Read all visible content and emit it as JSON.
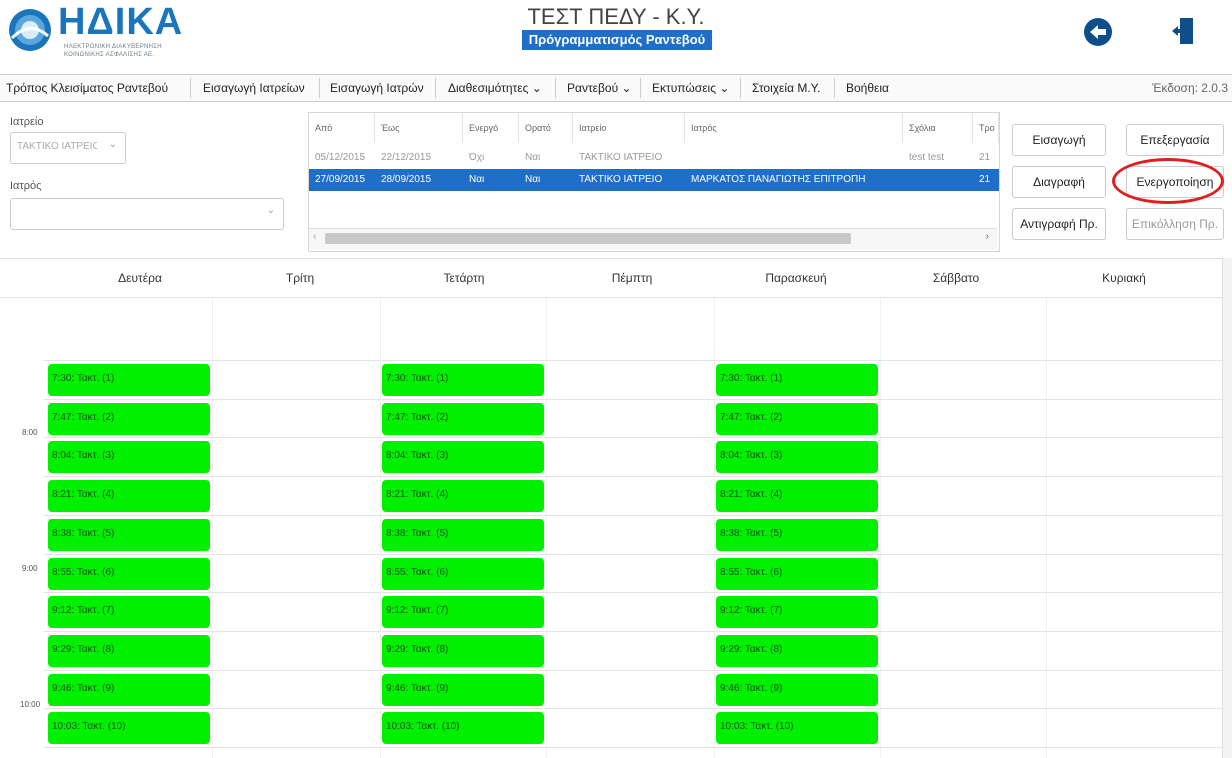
{
  "header": {
    "logo_text": "ΗΔΙΚΑ",
    "logo_sub_line1": "ΗΛΕΚΤΡΟΝΙΚΗ ΔΙΑΚΥΒΕΡΝΗΣΗ",
    "logo_sub_line2": "ΚΟΙΝΩΝΙΚΗΣ ΑΣΦΑΛΙΣΗΣ ΑΕ.",
    "title": "ΤΕΣΤ ΠΕΔΥ - Κ.Υ.",
    "subtitle": "Πρόγραμματισμός Ραντεβού"
  },
  "menu": {
    "items": [
      {
        "label": "Τρόπος Κλεισίματος Ραντεβού"
      },
      {
        "label": "Εισαγωγή Ιατρείων"
      },
      {
        "label": "Εισαγωγή Ιατρών"
      },
      {
        "label": "Διαθεσιμότητες ⌄"
      },
      {
        "label": "Ραντεβού ⌄"
      },
      {
        "label": "Εκτυπώσεις ⌄"
      },
      {
        "label": "Στοιχεία Μ.Υ."
      },
      {
        "label": "Βοήθεια"
      }
    ],
    "version": "Έκδοση: 2.0.3"
  },
  "filters": {
    "office_label": "Ιατρείο",
    "office_value": "ΤΑΚΤΙΚΟ ΙΑΤΡΕΙΟ",
    "doctor_label": "Ιατρός",
    "doctor_value": ""
  },
  "grid": {
    "columns": [
      "Από",
      "Έως",
      "Ενεργό",
      "Ορατό",
      "Ιατρείο",
      "Ιατρός",
      "Σχόλια",
      "Τρο"
    ],
    "rows": [
      {
        "from": "05/12/2015",
        "to": "22/12/2015",
        "active": "Όχι",
        "visible": "Ναι",
        "office": "ΤΑΚΤΙΚΟ ΙΑΤΡΕΙΟ",
        "doctor": "",
        "comments": "test test",
        "type": "21"
      },
      {
        "from": "27/09/2015",
        "to": "28/09/2015",
        "active": "Ναι",
        "visible": "Ναι",
        "office": "ΤΑΚΤΙΚΟ ΙΑΤΡΕΙΟ",
        "doctor": "ΜΑΡΚΑΤΟΣ ΠΑΝΑΓΙΩΤΗΣ ΕΠΙΤΡΟΠΗ",
        "comments": "",
        "type": "21"
      }
    ]
  },
  "actions": {
    "insert": "Εισαγωγή",
    "edit": "Επεξεργασία",
    "delete": "Διαγραφή",
    "activate": "Ενεργοποίηση",
    "copy": "Αντιγραφή Πρ.",
    "overlay": "Επικόλληση Πρ."
  },
  "calendar": {
    "days": [
      "Δευτέρα",
      "Τρίτη",
      "Τετάρτη",
      "Πέμπτη",
      "Παρασκευή",
      "Σάββατο",
      "Κυριακή"
    ],
    "hour_labels": [
      "8:00",
      "9:00",
      "10:00"
    ],
    "slot_days": [
      "Δευτέρα",
      "Τετάρτη",
      "Παρασκευή"
    ],
    "slots": [
      "7:30: Τακτ. (1)",
      "7:47: Τακτ. (2)",
      "8:04: Τακτ. (3)",
      "8:21: Τακτ. (4)",
      "8:38: Τακτ. (5)",
      "8:55: Τακτ. (6)",
      "9:12: Τακτ. (7)",
      "9:29: Τακτ. (8)",
      "9:46: Τακτ. (9)",
      "10:03: Τακτ. (10)"
    ],
    "slot_color": "#00f000"
  },
  "colors": {
    "brand": "#1b75bb",
    "selection": "#1f6fc9",
    "highlight_ring": "#e01e1e"
  }
}
